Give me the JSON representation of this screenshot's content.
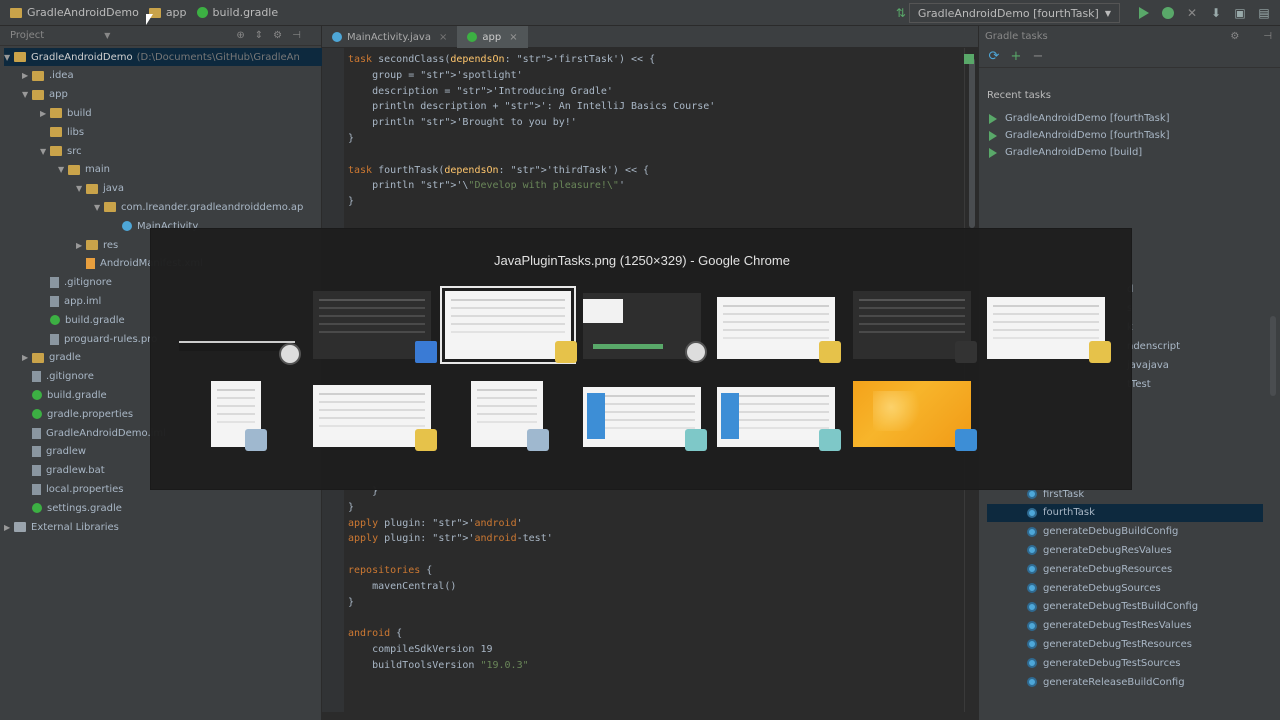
{
  "navbar": {
    "breadcrumbs": [
      "GradleAndroidDemo",
      "app",
      "build.gradle"
    ],
    "run_config": "GradleAndroidDemo [fourthTask]"
  },
  "project_panel": {
    "title": "Project",
    "rows": [
      {
        "label": "GradleAndroidDemo",
        "path": "(D:\\Documents\\GitHub\\GradleAn",
        "icon": "folder-icon",
        "arrow": "▼"
      },
      {
        "label": ".idea",
        "icon": "folder-icon",
        "arrow": "▶"
      },
      {
        "label": "app",
        "icon": "folder-icon",
        "arrow": "▼"
      },
      {
        "label": "build",
        "icon": "folder-icon",
        "arrow": "▶"
      },
      {
        "label": "libs",
        "icon": "folder-icon",
        "arrow": ""
      },
      {
        "label": "src",
        "icon": "folder-icon",
        "arrow": "▼"
      },
      {
        "label": "main",
        "icon": "folder-icon",
        "arrow": "▼"
      },
      {
        "label": "java",
        "icon": "folder-icon",
        "arrow": "▼"
      },
      {
        "label": "com.lreander.gradleandroiddemo.ap",
        "icon": "folder-icon",
        "arrow": "▼"
      },
      {
        "label": "MainActivity",
        "icon": "class-icon",
        "arrow": ""
      },
      {
        "label": "res",
        "icon": "folder-icon",
        "arrow": "▶"
      },
      {
        "label": "AndroidManifest.xml",
        "icon": "xml-icon",
        "arrow": ""
      },
      {
        "label": ".gitignore",
        "icon": "file-icon",
        "arrow": ""
      },
      {
        "label": "app.iml",
        "icon": "file-icon",
        "arrow": ""
      },
      {
        "label": "build.gradle",
        "icon": "gradle-icon",
        "arrow": ""
      },
      {
        "label": "proguard-rules.pro",
        "icon": "file-icon",
        "arrow": ""
      },
      {
        "label": "gradle",
        "icon": "folder-icon",
        "arrow": "▶"
      },
      {
        "label": ".gitignore",
        "icon": "file-icon",
        "arrow": ""
      },
      {
        "label": "build.gradle",
        "icon": "gradle-icon",
        "arrow": ""
      },
      {
        "label": "gradle.properties",
        "icon": "gradle-icon",
        "arrow": ""
      },
      {
        "label": "GradleAndroidDemo.iml",
        "icon": "file-icon",
        "arrow": ""
      },
      {
        "label": "gradlew",
        "icon": "file-icon",
        "arrow": ""
      },
      {
        "label": "gradlew.bat",
        "icon": "file-icon",
        "arrow": ""
      },
      {
        "label": "local.properties",
        "icon": "file-icon",
        "arrow": ""
      },
      {
        "label": "settings.gradle",
        "icon": "gradle-icon",
        "arrow": ""
      },
      {
        "label": "External Libraries",
        "icon": "library-icon",
        "arrow": "▶"
      }
    ]
  },
  "editor": {
    "tabs": [
      "MainActivity.java",
      "app"
    ],
    "code_top": [
      "task secondClass(dependsOn: 'firstTask') << {",
      "    group = 'spotlight'",
      "    description = 'Introducing Gradle'",
      "    println description + ': An IntelliJ Basics Course'",
      "    println 'Brought to you by!'",
      "}",
      "",
      "task fourthTask(dependsOn: 'thirdTask') << {",
      "    println '\\\"Develop with pleasure!\\\"'",
      "}"
    ],
    "code_bottom": [
      "    }",
      "}",
      "apply plugin: 'android'",
      "apply plugin: 'android-test'",
      "",
      "repositories {",
      "    mavenCentral()",
      "}",
      "",
      "android {",
      "    compileSdkVersion 19",
      "    buildToolsVersion \"19.0.3\""
    ]
  },
  "gradle_panel": {
    "title": "Gradle tasks",
    "recent_title": "Recent tasks",
    "recent": [
      "GradleAndroidDemo [fourthTask]",
      "GradleAndroidDemo [fourthTask]",
      "GradleAndroidDemo [build]"
    ],
    "partial": [
      "d",
      "s",
      "k",
      "ndenscript",
      "javajava",
      "tTest"
    ],
    "tasks": [
      "firstTask",
      "fourthTask",
      "generateDebugBuildConfig",
      "generateDebugResValues",
      "generateDebugResources",
      "generateDebugSources",
      "generateDebugTestBuildConfig",
      "generateDebugTestResValues",
      "generateDebugTestResources",
      "generateDebugTestSources",
      "generateReleaseBuildConfig"
    ],
    "selected_task": "fourthTask"
  },
  "switcher": {
    "title": "JavaPluginTasks.png (1250×329) - Google Chrome",
    "selected_index": 2,
    "windows": [
      {
        "kind": "dark-strip",
        "badge": "settings-icon"
      },
      {
        "kind": "dark",
        "badge": "intellij-icon"
      },
      {
        "kind": "light",
        "badge": "folder-icon"
      },
      {
        "kind": "dark-toolbar",
        "badge": "settings-icon"
      },
      {
        "kind": "light",
        "badge": "folder-icon"
      },
      {
        "kind": "dark",
        "badge": "terminal-icon"
      },
      {
        "kind": "light",
        "badge": "folder-icon"
      },
      {
        "kind": "light-small",
        "badge": "window-icon"
      },
      {
        "kind": "light",
        "badge": "folder-icon"
      },
      {
        "kind": "light-small",
        "badge": "window-icon"
      },
      {
        "kind": "blue-app",
        "badge": "app-icon"
      },
      {
        "kind": "blue-app",
        "badge": "app-icon"
      },
      {
        "kind": "orange",
        "badge": "desktop-icon"
      }
    ]
  },
  "colors": {
    "ide_bg": "#2b2b2b",
    "panel_bg": "#3c3f41",
    "selection": "#0d293e",
    "run_green": "#59a869",
    "switcher_bg": "#1e1e1e"
  }
}
